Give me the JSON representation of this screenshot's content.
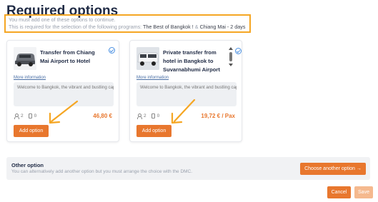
{
  "page": {
    "title": "Required options"
  },
  "notice": {
    "line1": "You must add one of these options to continue.",
    "line2_prefix": "This is required for the selection of the following programs: ",
    "program1": "The Best of Bangkok !",
    "separator": " & ",
    "program2": "Chiang Mai - 2 days"
  },
  "options": [
    {
      "title": "Transfer from Chiang Mai Airport to Hotel",
      "more_info": "More information",
      "description": "Welcome to Bangkok, the vibrant and bustling capi",
      "adults": "2",
      "luggage": "0",
      "price": "46,80 €",
      "add_label": "Add option"
    },
    {
      "title": "Private transfer from hotel in Bangkok to Suvarnabhumi Airport",
      "more_info": "More information",
      "description": "Welcome to Bangkok, the vibrant and bustling capi",
      "adults": "2",
      "luggage": "0",
      "price": "19,72 € / Pax",
      "add_label": "Add option"
    }
  ],
  "other_option": {
    "title": "Other option",
    "subtitle": "You can alternatively add another option but you must arrange the choice with the DMC.",
    "button_label": "Choose another option →"
  },
  "footer": {
    "cancel_label": "Cancel",
    "save_label": "Save"
  },
  "colors": {
    "accent": "#e8772e",
    "highlight": "#f5a623",
    "title": "#1f2a44"
  }
}
